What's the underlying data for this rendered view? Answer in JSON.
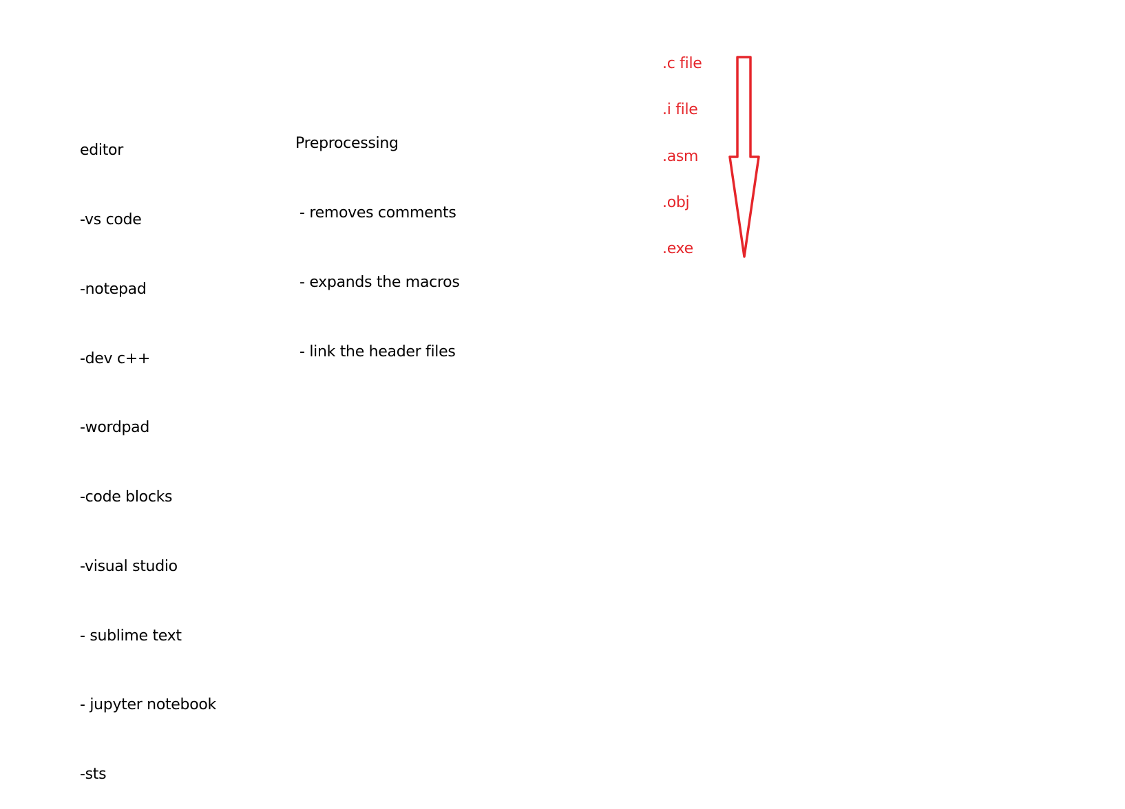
{
  "editor": {
    "title": "editor",
    "items": [
      "-vs code",
      "-notepad",
      "-dev c++",
      "-wordpad",
      "-code blocks",
      "-visual studio",
      "- sublime text",
      "- jupyter notebook",
      "-sts"
    ]
  },
  "preprocessing": {
    "title": "Preprocessing",
    "items": [
      "- removes comments",
      "- expands the macros",
      "- link the header files"
    ]
  },
  "pipeline": {
    "files": [
      ".c file",
      ".i file",
      ".asm",
      ".obj",
      ".exe"
    ],
    "arrow_color": "#e5262b",
    "arrow_direction": "down",
    "arrow_icon": "down-arrow-icon"
  }
}
